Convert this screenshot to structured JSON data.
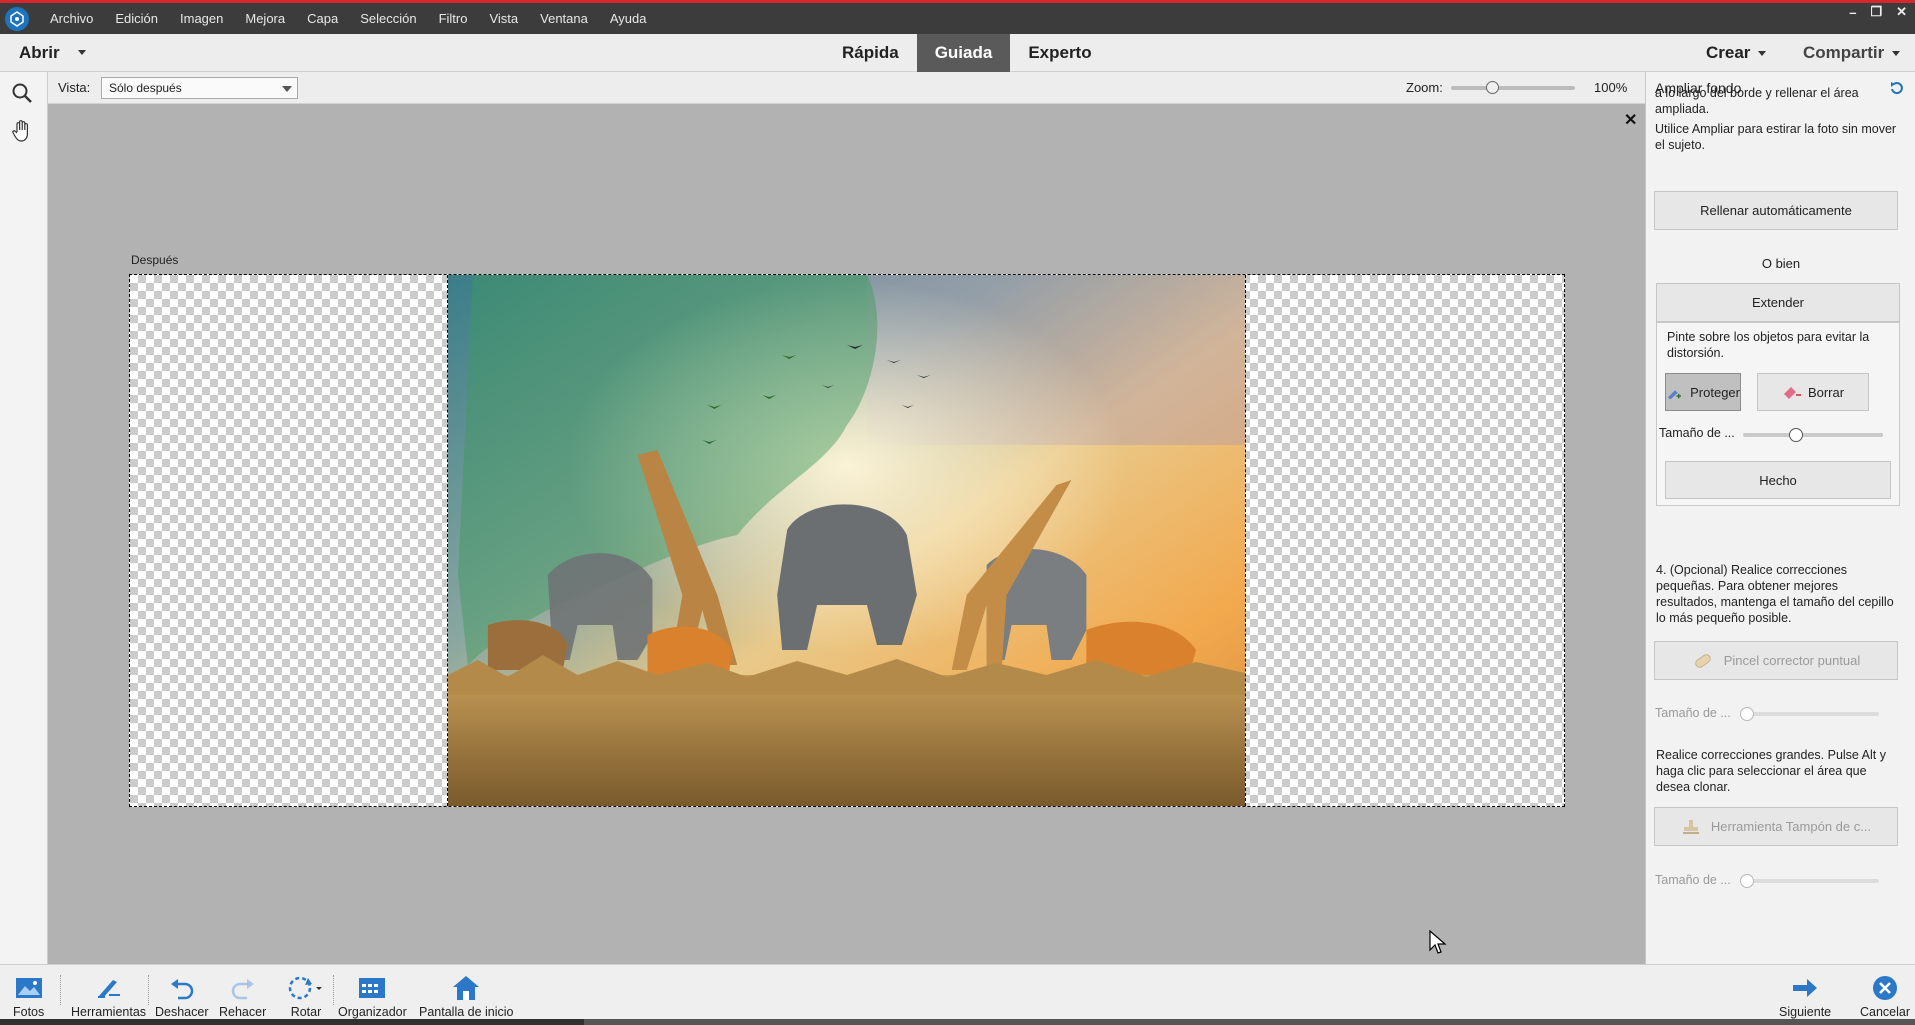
{
  "menu": {
    "items": [
      "Archivo",
      "Edición",
      "Imagen",
      "Mejora",
      "Capa",
      "Selección",
      "Filtro",
      "Vista",
      "Ventana",
      "Ayuda"
    ],
    "window_controls": [
      "–",
      "❐",
      "✕"
    ]
  },
  "modebar": {
    "open_label": "Abrir",
    "tabs": [
      "Rápida",
      "Guiada",
      "Experto"
    ],
    "active_tab": "Guiada",
    "create_label": "Crear",
    "share_label": "Compartir"
  },
  "options": {
    "vista_label": "Vista:",
    "vista_value": "Sólo después",
    "zoom_label": "Zoom:",
    "zoom_value": "100%",
    "zoom_fraction": 0.34
  },
  "canvas": {
    "after_label": "Después"
  },
  "panel": {
    "title": "Ampliar fondo",
    "text_top": "a lo largo del borde y rellenar el área ampliada.",
    "text_ampliar": "Utilice Ampliar para estirar la foto sin mover el sujeto.",
    "autofill_button": "Rellenar automáticamente",
    "or_label": "O bien",
    "extend_button": "Extender",
    "protect_hint": "Pinte sobre los objetos para evitar la distorsión.",
    "protect_button": "Proteger",
    "erase_button": "Borrar",
    "brush_size_label": "Tamaño de ...",
    "brush_size_fraction": 0.38,
    "done_button": "Hecho",
    "step4_text": "4. (Opcional) Realice correcciones pequeñas. Para obtener mejores resultados, mantenga el tamaño del cepillo lo más pequeño posible.",
    "spot_healing_button": "Pincel corrector puntual",
    "spot_size_label": "Tamaño de ...",
    "spot_size_fraction": 0.05,
    "clone_text": "Realice correcciones grandes. Pulse Alt y haga clic para seleccionar el área que desea clonar.",
    "clone_button": "Herramienta Tampón de c...",
    "clone_size_label": "Tamaño de ...",
    "clone_size_fraction": 0.05
  },
  "bottom": {
    "photos": "Fotos",
    "tools": "Herramientas",
    "undo": "Deshacer",
    "redo": "Rehacer",
    "rotate": "Rotar",
    "organizer": "Organizador",
    "home": "Pantalla de inicio",
    "next": "Siguiente",
    "cancel": "Cancelar"
  },
  "colors": {
    "accent": "#1e73be",
    "menubar": "#3c3c3c",
    "active_tab": "#5a5a5a",
    "redline": "#d7262e"
  }
}
